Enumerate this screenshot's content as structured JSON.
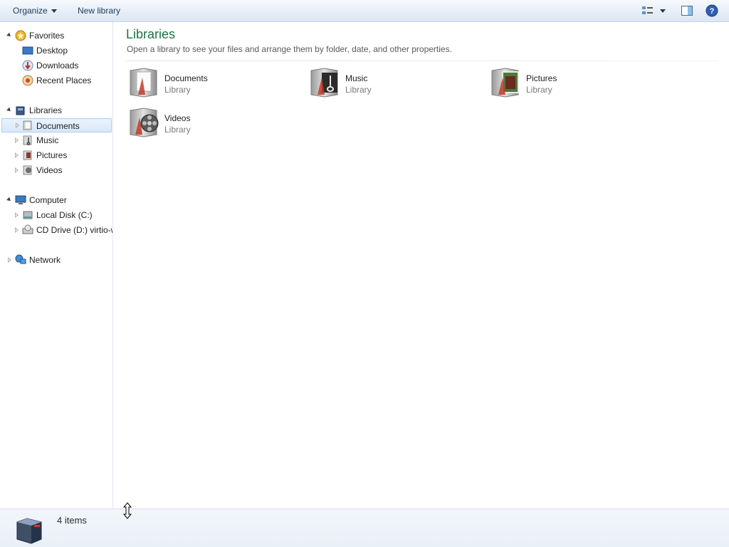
{
  "toolbar": {
    "organize_label": "Organize",
    "new_library_label": "New library",
    "icons": [
      "view-options-icon",
      "chevron-down-icon",
      "preview-pane-icon",
      "help-icon"
    ]
  },
  "nav": {
    "favorites": {
      "label": "Favorites",
      "items": [
        {
          "label": "Desktop",
          "icon": "desktop-icon"
        },
        {
          "label": "Downloads",
          "icon": "downloads-icon"
        },
        {
          "label": "Recent Places",
          "icon": "recent-places-icon"
        }
      ]
    },
    "libraries": {
      "label": "Libraries",
      "items": [
        {
          "label": "Documents",
          "icon": "documents-library-icon",
          "selected": true
        },
        {
          "label": "Music",
          "icon": "music-library-icon"
        },
        {
          "label": "Pictures",
          "icon": "pictures-library-icon"
        },
        {
          "label": "Videos",
          "icon": "videos-library-icon"
        }
      ]
    },
    "computer": {
      "label": "Computer",
      "items": [
        {
          "label": "Local Disk (C:)",
          "icon": "local-disk-icon"
        },
        {
          "label": "CD Drive (D:) virtio-w",
          "icon": "cd-drive-icon"
        }
      ]
    },
    "network": {
      "label": "Network",
      "icon": "network-icon"
    }
  },
  "content": {
    "title": "Libraries",
    "description": "Open a library to see your files and arrange them by folder, date, and other properties.",
    "libraries": [
      {
        "name": "Documents",
        "type": "Library",
        "icon": "documents-library-icon"
      },
      {
        "name": "Music",
        "type": "Library",
        "icon": "music-library-icon"
      },
      {
        "name": "Pictures",
        "type": "Library",
        "icon": "pictures-library-icon"
      },
      {
        "name": "Videos",
        "type": "Library",
        "icon": "videos-library-icon"
      }
    ]
  },
  "details": {
    "item_count": "4 items",
    "icon": "libraries-icon"
  },
  "colors": {
    "title_green": "#1e7145",
    "toolbar_text": "#1e395b",
    "selection_border": "#a8cff4"
  }
}
